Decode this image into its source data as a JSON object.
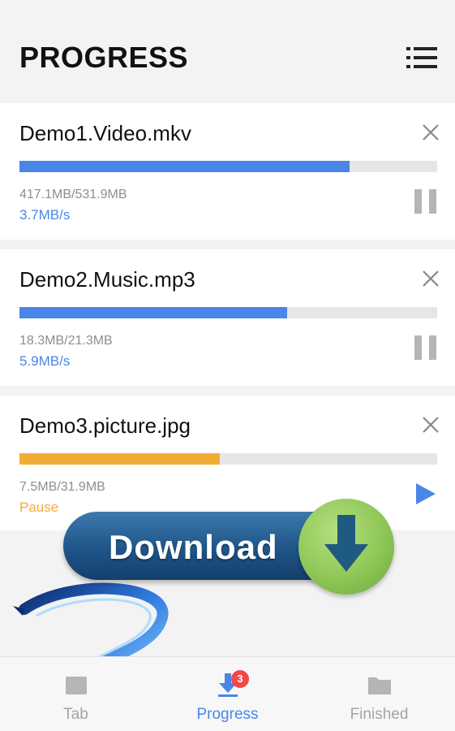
{
  "header": {
    "title": "PROGRESS",
    "menu_icon": "list-menu-icon"
  },
  "downloads": [
    {
      "name": "Demo1.Video.mkv",
      "size": "417.1MB/531.9MB",
      "status": "3.7MB/s",
      "progress": 0.79,
      "state": "downloading",
      "action_icon": "pause-icon"
    },
    {
      "name": "Demo2.Music.mp3",
      "size": "18.3MB/21.3MB",
      "status": "5.9MB/s",
      "progress": 0.64,
      "state": "downloading",
      "action_icon": "pause-icon"
    },
    {
      "name": "Demo3.picture.jpg",
      "size": "7.5MB/31.9MB",
      "status": "Pause",
      "progress": 0.48,
      "state": "paused",
      "action_icon": "play-icon"
    }
  ],
  "banner": {
    "text": "Download"
  },
  "bottom_nav": {
    "items": [
      {
        "label": "Tab",
        "icon": "tab-icon"
      },
      {
        "label": "Progress",
        "icon": "download-icon",
        "badge": "3",
        "active": true
      },
      {
        "label": "Finished",
        "icon": "folder-icon"
      }
    ]
  },
  "colors": {
    "accent": "#4a86e8",
    "paused": "#f2ac33",
    "badge": "#f04848",
    "banner_green": "#8ec757",
    "banner_blue": "#1f5588"
  }
}
